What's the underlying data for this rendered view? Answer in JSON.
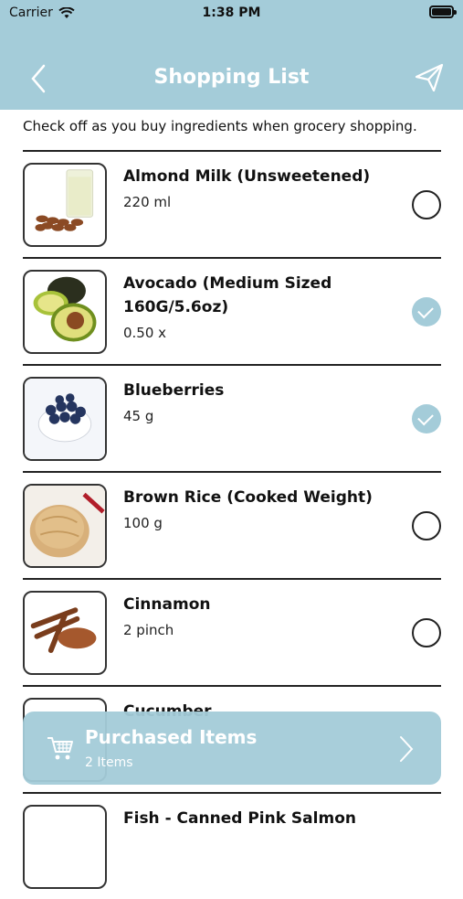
{
  "status": {
    "carrier": "Carrier",
    "time": "1:38 PM"
  },
  "nav": {
    "title": "Shopping List"
  },
  "hint": "Check off as you buy ingredients when grocery shopping.",
  "items": [
    {
      "name": "Almond Milk (Unsweetened)",
      "qty": "220 ml",
      "checked": false,
      "icon": "almond-milk-photo"
    },
    {
      "name": "Avocado (Medium Sized 160G/5.6oz)",
      "qty": "0.50 x",
      "checked": true,
      "icon": "avocado-photo"
    },
    {
      "name": "Blueberries",
      "qty": "45 g",
      "checked": true,
      "icon": "blueberries-photo"
    },
    {
      "name": "Brown Rice (Cooked Weight)",
      "qty": "100 g",
      "checked": false,
      "icon": "brown-rice-photo"
    },
    {
      "name": "Cinnamon",
      "qty": "2 pinch",
      "checked": false,
      "icon": "cinnamon-photo"
    },
    {
      "name": "Cucumber",
      "qty": "",
      "checked": false,
      "icon": "cucumber-photo"
    },
    {
      "name": "Fish - Canned Pink Salmon",
      "qty": "",
      "checked": false,
      "icon": "salmon-photo"
    }
  ],
  "purchased": {
    "title": "Purchased Items",
    "count": "2 Items"
  },
  "colors": {
    "accent": "#a4ccd9"
  }
}
